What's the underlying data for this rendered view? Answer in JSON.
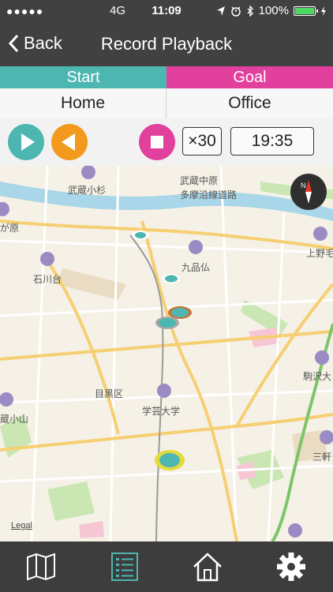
{
  "status": {
    "signal": "●●●●●",
    "network": "4G",
    "time": "11:09",
    "battery": "100%"
  },
  "nav": {
    "back_label": "Back",
    "title": "Record Playback"
  },
  "route": {
    "start_label": "Start",
    "goal_label": "Goal",
    "start_place": "Home",
    "goal_place": "Office"
  },
  "controls": {
    "speed": "×30",
    "time": "19:35"
  },
  "map": {
    "labels": [
      "武蔵小杉",
      "武蔵中原",
      "多摩沿線道路",
      "が原",
      "上野毛",
      "九品仏",
      "石川台",
      "駒沢大",
      "目黒区",
      "学芸大学",
      "蔵小山",
      "三軒"
    ],
    "legal": "Legal",
    "compass_letter": "N"
  },
  "tabs": [
    "map-icon",
    "list-icon",
    "home-icon",
    "gear-icon"
  ],
  "colors": {
    "teal": "#4db6b1",
    "pink": "#e2409d",
    "orange": "#f39a1e"
  }
}
